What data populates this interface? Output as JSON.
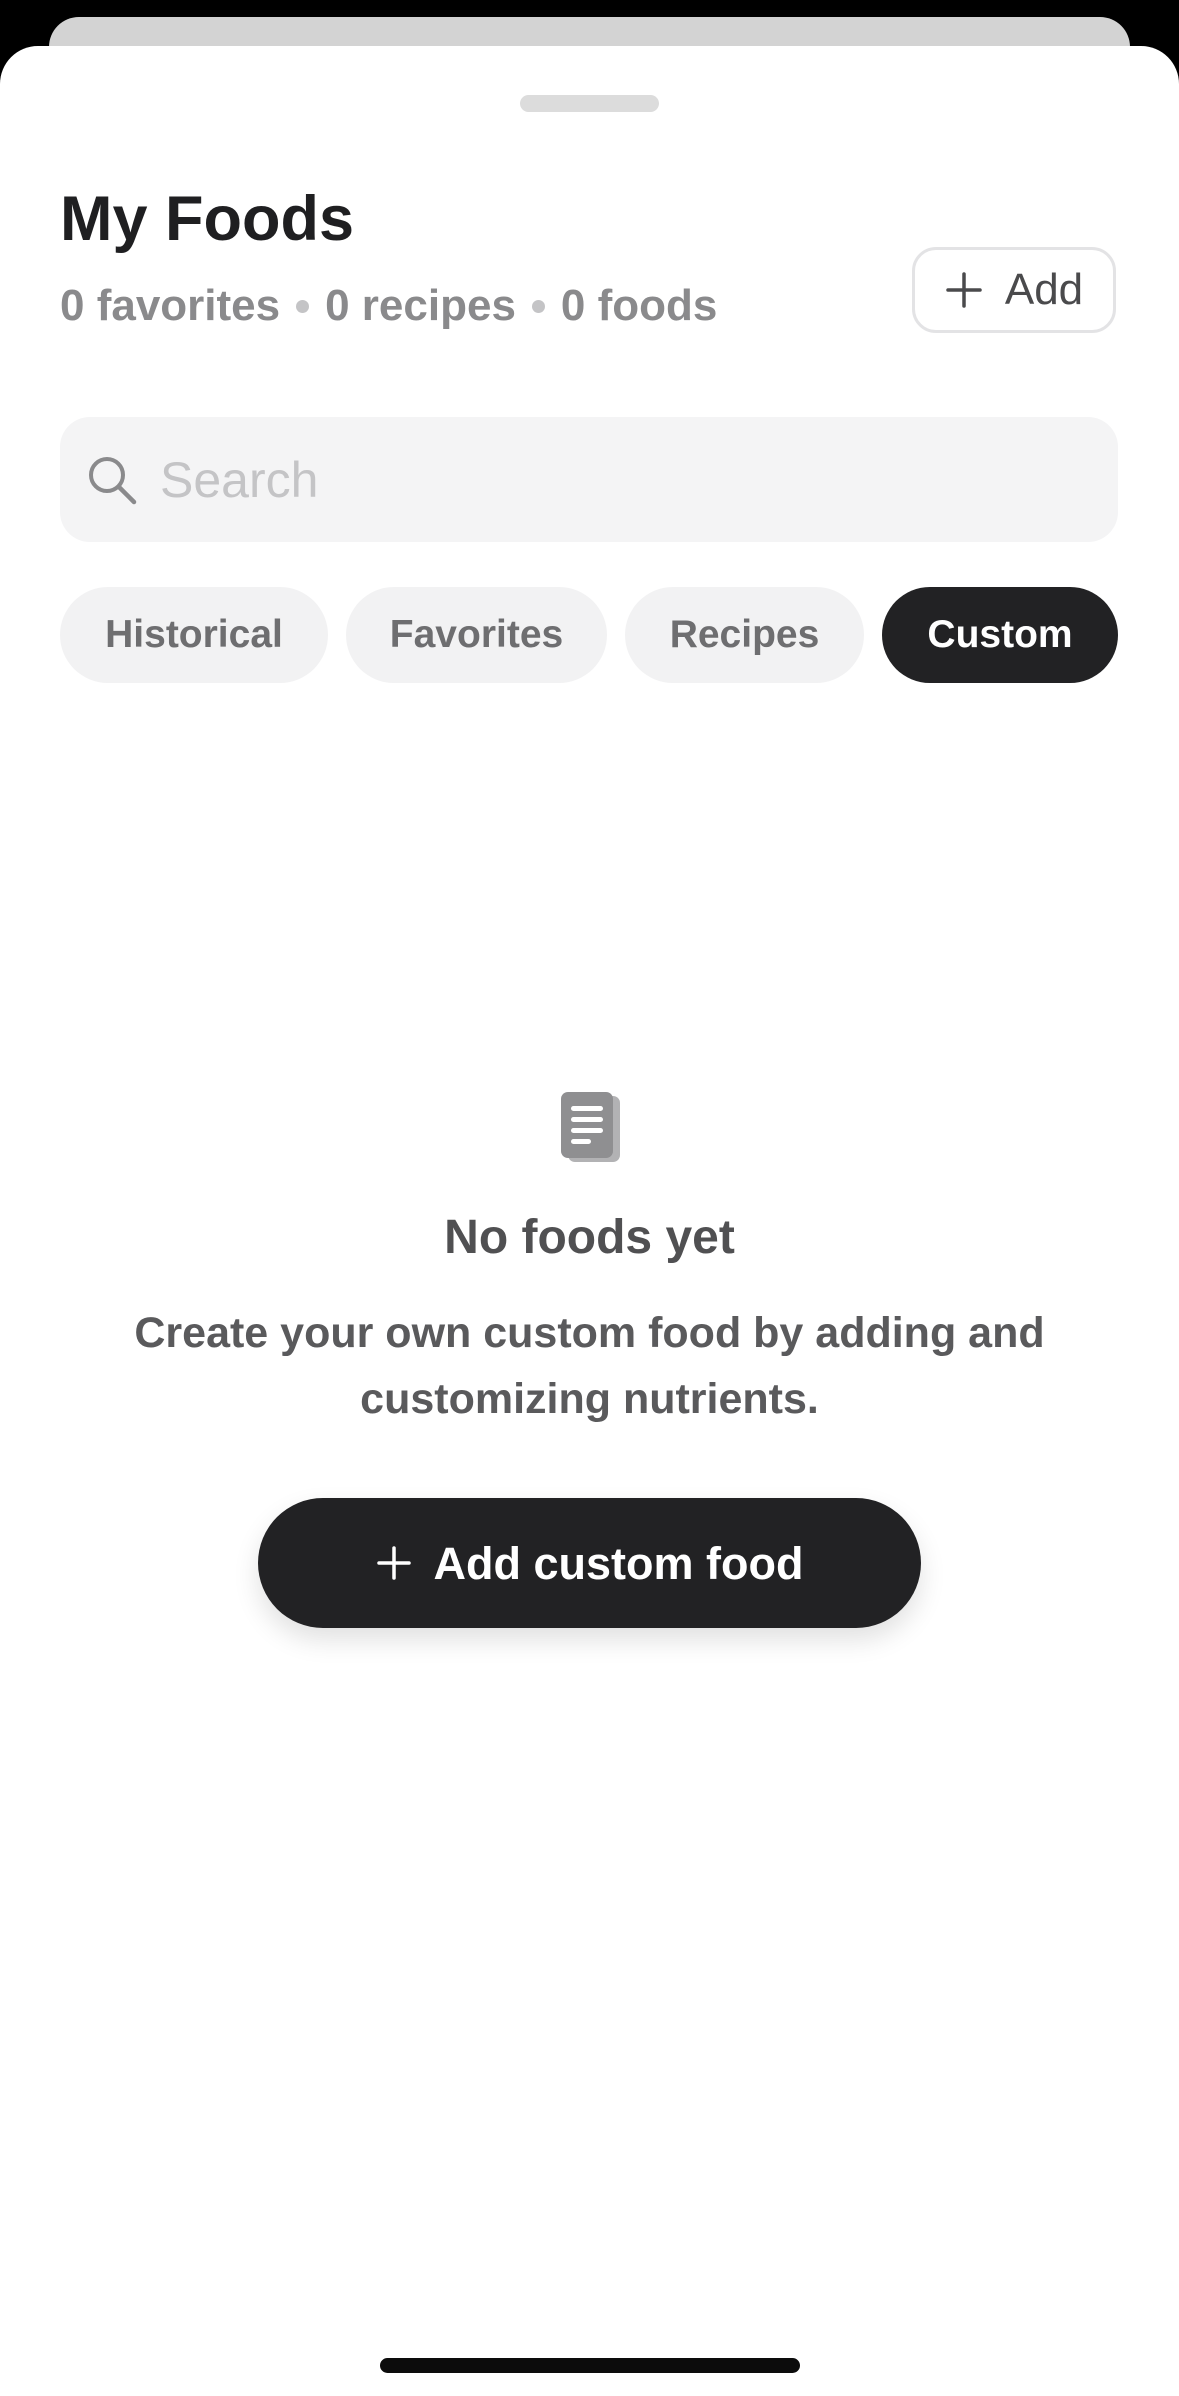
{
  "header": {
    "title": "My Foods",
    "counts": {
      "favorites": "0 favorites",
      "recipes": "0 recipes",
      "foods": "0 foods"
    },
    "add_label": "Add",
    "add_icon": "plus-icon"
  },
  "search": {
    "placeholder": "Search",
    "value": "",
    "icon": "search-icon"
  },
  "tabs": [
    {
      "label": "Historical",
      "active": false
    },
    {
      "label": "Favorites",
      "active": false
    },
    {
      "label": "Recipes",
      "active": false
    },
    {
      "label": "Custom",
      "active": true
    }
  ],
  "empty_state": {
    "icon": "document-icon",
    "title": "No foods yet",
    "description": "Create your own custom food by adding and customizing nutrients.",
    "cta_label": "Add custom food",
    "cta_icon": "plus-icon"
  },
  "colors": {
    "accent_dark": "#222224",
    "muted_text": "#8a8a8c",
    "chip_bg": "#f2f2f3",
    "search_bg": "#f4f4f5"
  }
}
